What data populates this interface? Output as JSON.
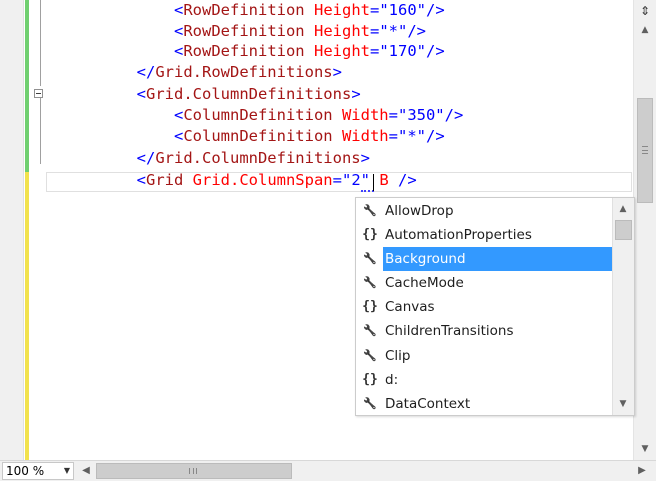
{
  "code_lines": [
    {
      "indent": "            ",
      "parts": [
        {
          "t": "<",
          "c": "blue"
        },
        {
          "t": "RowDefinition",
          "c": "red"
        },
        {
          "t": " Height",
          "c": "attr"
        },
        {
          "t": "=",
          "c": "blue"
        },
        {
          "t": "\"160\"",
          "c": "val"
        },
        {
          "t": "/>",
          "c": "blue"
        }
      ]
    },
    {
      "indent": "            ",
      "parts": [
        {
          "t": "<",
          "c": "blue"
        },
        {
          "t": "RowDefinition",
          "c": "red"
        },
        {
          "t": " Height",
          "c": "attr"
        },
        {
          "t": "=",
          "c": "blue"
        },
        {
          "t": "\"*\"",
          "c": "val"
        },
        {
          "t": "/>",
          "c": "blue"
        }
      ]
    },
    {
      "indent": "            ",
      "parts": [
        {
          "t": "<",
          "c": "blue"
        },
        {
          "t": "RowDefinition",
          "c": "red"
        },
        {
          "t": " Height",
          "c": "attr"
        },
        {
          "t": "=",
          "c": "blue"
        },
        {
          "t": "\"170\"",
          "c": "val"
        },
        {
          "t": "/>",
          "c": "blue"
        }
      ]
    },
    {
      "indent": "        ",
      "parts": [
        {
          "t": "</",
          "c": "blue"
        },
        {
          "t": "Grid.RowDefinitions",
          "c": "red"
        },
        {
          "t": ">",
          "c": "blue"
        }
      ]
    },
    {
      "indent": "        ",
      "parts": [
        {
          "t": "<",
          "c": "blue"
        },
        {
          "t": "Grid.ColumnDefinitions",
          "c": "red"
        },
        {
          "t": ">",
          "c": "blue"
        }
      ]
    },
    {
      "indent": "            ",
      "parts": [
        {
          "t": "<",
          "c": "blue"
        },
        {
          "t": "ColumnDefinition",
          "c": "red"
        },
        {
          "t": " Width",
          "c": "attr"
        },
        {
          "t": "=",
          "c": "blue"
        },
        {
          "t": "\"350\"",
          "c": "val"
        },
        {
          "t": "/>",
          "c": "blue"
        }
      ]
    },
    {
      "indent": "            ",
      "parts": [
        {
          "t": "<",
          "c": "blue"
        },
        {
          "t": "ColumnDefinition",
          "c": "red"
        },
        {
          "t": " Width",
          "c": "attr"
        },
        {
          "t": "=",
          "c": "blue"
        },
        {
          "t": "\"*\"",
          "c": "val"
        },
        {
          "t": "/>",
          "c": "blue"
        }
      ]
    },
    {
      "indent": "        ",
      "parts": [
        {
          "t": "</",
          "c": "blue"
        },
        {
          "t": "Grid.ColumnDefinitions",
          "c": "red"
        },
        {
          "t": ">",
          "c": "blue"
        }
      ]
    },
    {
      "indent": "        ",
      "parts": [
        {
          "t": "<",
          "c": "blue"
        },
        {
          "t": "Grid",
          "c": "red"
        },
        {
          "t": " Grid.ColumnSpan",
          "c": "attr"
        },
        {
          "t": "=",
          "c": "blue"
        },
        {
          "t": "\"2\"",
          "c": "val"
        },
        {
          "t": " B",
          "c": "attr"
        },
        {
          "t": " />",
          "c": "blue"
        }
      ]
    }
  ],
  "completion": {
    "items": [
      {
        "label": "AllowDrop",
        "icon": "wrench-icon",
        "glyph": "🔧"
      },
      {
        "label": "AutomationProperties",
        "icon": "braces-icon",
        "glyph": "{}"
      },
      {
        "label": "Background",
        "icon": "wrench-icon",
        "glyph": "🔧",
        "selected": true
      },
      {
        "label": "CacheMode",
        "icon": "wrench-icon",
        "glyph": "🔧"
      },
      {
        "label": "Canvas",
        "icon": "braces-icon",
        "glyph": "{}"
      },
      {
        "label": "ChildrenTransitions",
        "icon": "wrench-icon",
        "glyph": "🔧"
      },
      {
        "label": "Clip",
        "icon": "wrench-icon",
        "glyph": "🔧"
      },
      {
        "label": "d:",
        "icon": "braces-icon",
        "glyph": "{}"
      },
      {
        "label": "DataContext",
        "icon": "wrench-icon",
        "glyph": "🔧"
      }
    ]
  },
  "status": {
    "zoom": "100 %"
  },
  "colors": {
    "selection": "#3399ff",
    "change_saved": "#6fcf6f",
    "change_unsaved": "#f2e24d"
  }
}
